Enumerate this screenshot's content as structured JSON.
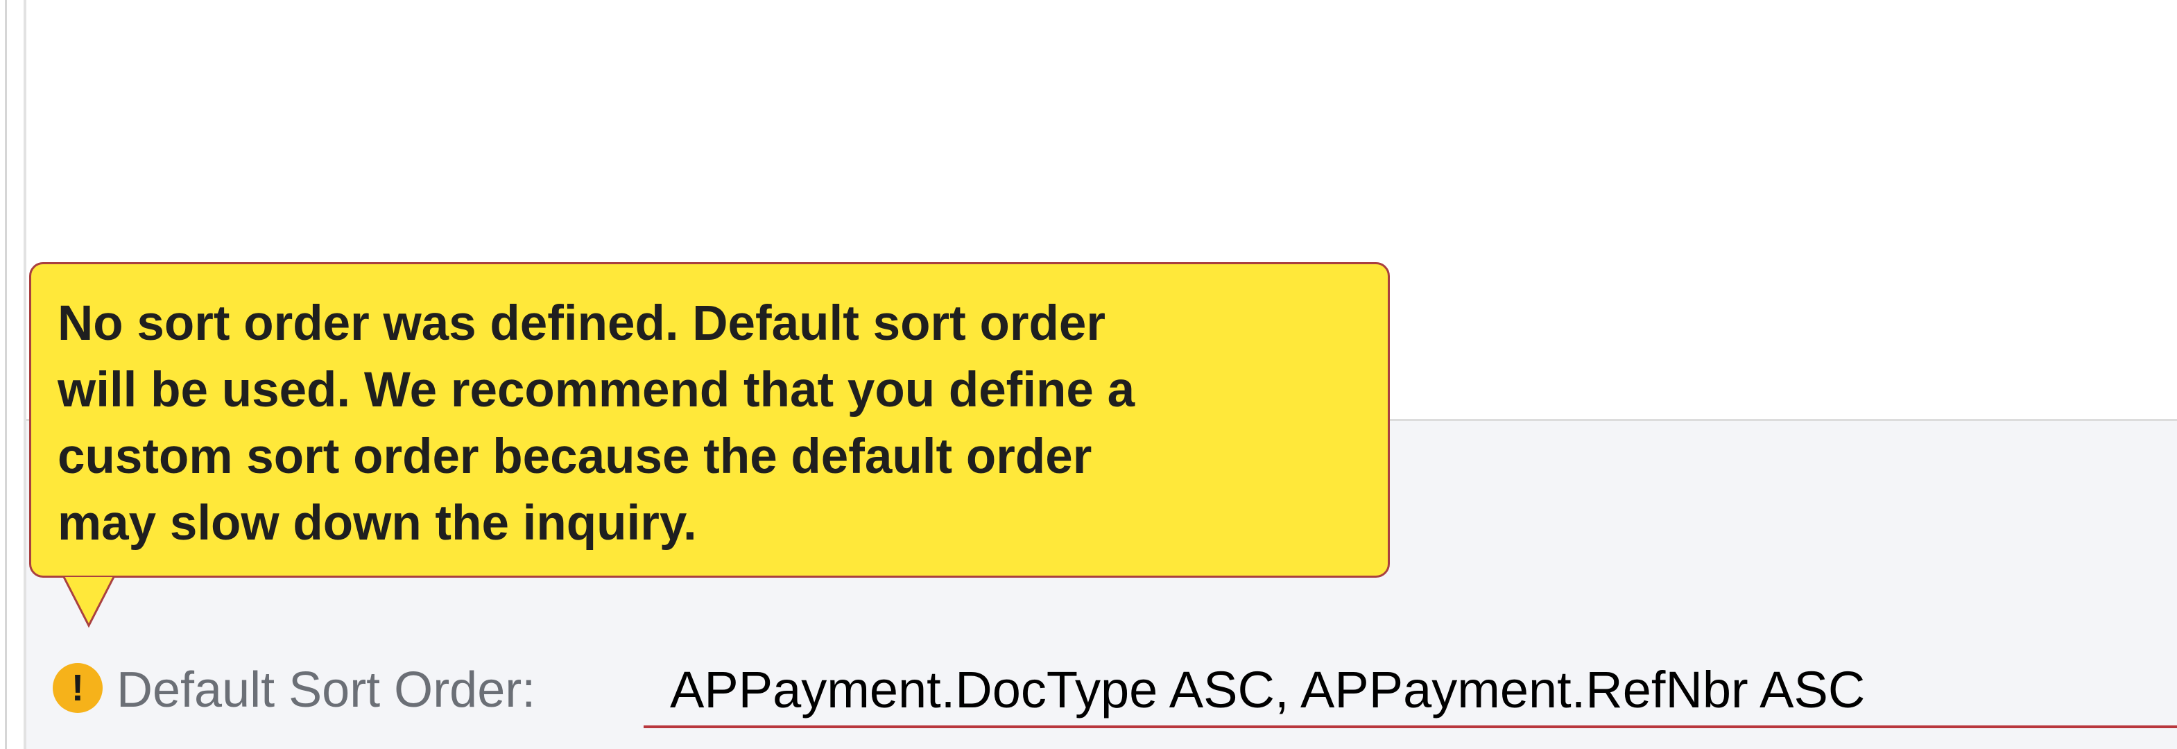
{
  "tooltip": {
    "message": "No sort order was defined. Default sort order\nwill be used. We recommend that you define a\ncustom sort order because the default order\nmay slow down the inquiry."
  },
  "field": {
    "warning_glyph": "!",
    "label": "Default Sort Order:",
    "value": "APPayment.DocType ASC, APPayment.RefNbr ASC"
  },
  "colors": {
    "tooltip_background": "#ffe83a",
    "tooltip_border": "#a94040",
    "warning_icon": "#f6b21a",
    "error_underline": "#b8373d",
    "form_background": "#f4f5f8"
  },
  "icons": {
    "warning": "warning-icon"
  }
}
